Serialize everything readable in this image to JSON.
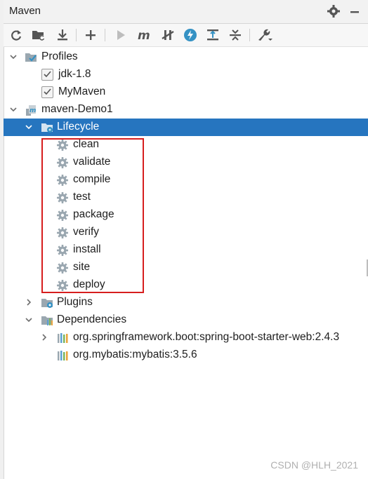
{
  "window": {
    "title": "Maven"
  },
  "tree": {
    "profiles": {
      "label": "Profiles",
      "items": [
        {
          "label": "jdk-1.8",
          "checked": true
        },
        {
          "label": "MyMaven",
          "checked": true
        }
      ]
    },
    "project": {
      "label": "maven-Demo1",
      "lifecycle": {
        "label": "Lifecycle",
        "phases": [
          "clean",
          "validate",
          "compile",
          "test",
          "package",
          "verify",
          "install",
          "site",
          "deploy"
        ]
      },
      "plugins": {
        "label": "Plugins"
      },
      "dependencies": {
        "label": "Dependencies",
        "items": [
          {
            "label": "org.springframework.boot:spring-boot-starter-web:2.4.3"
          },
          {
            "label": "org.mybatis:mybatis:3.5.6"
          }
        ]
      }
    }
  },
  "colors": {
    "selection": "#2675bf",
    "highlight_box": "#d71e1e",
    "accent": "#3592c4"
  },
  "watermark": "CSDN @HLH_2021"
}
